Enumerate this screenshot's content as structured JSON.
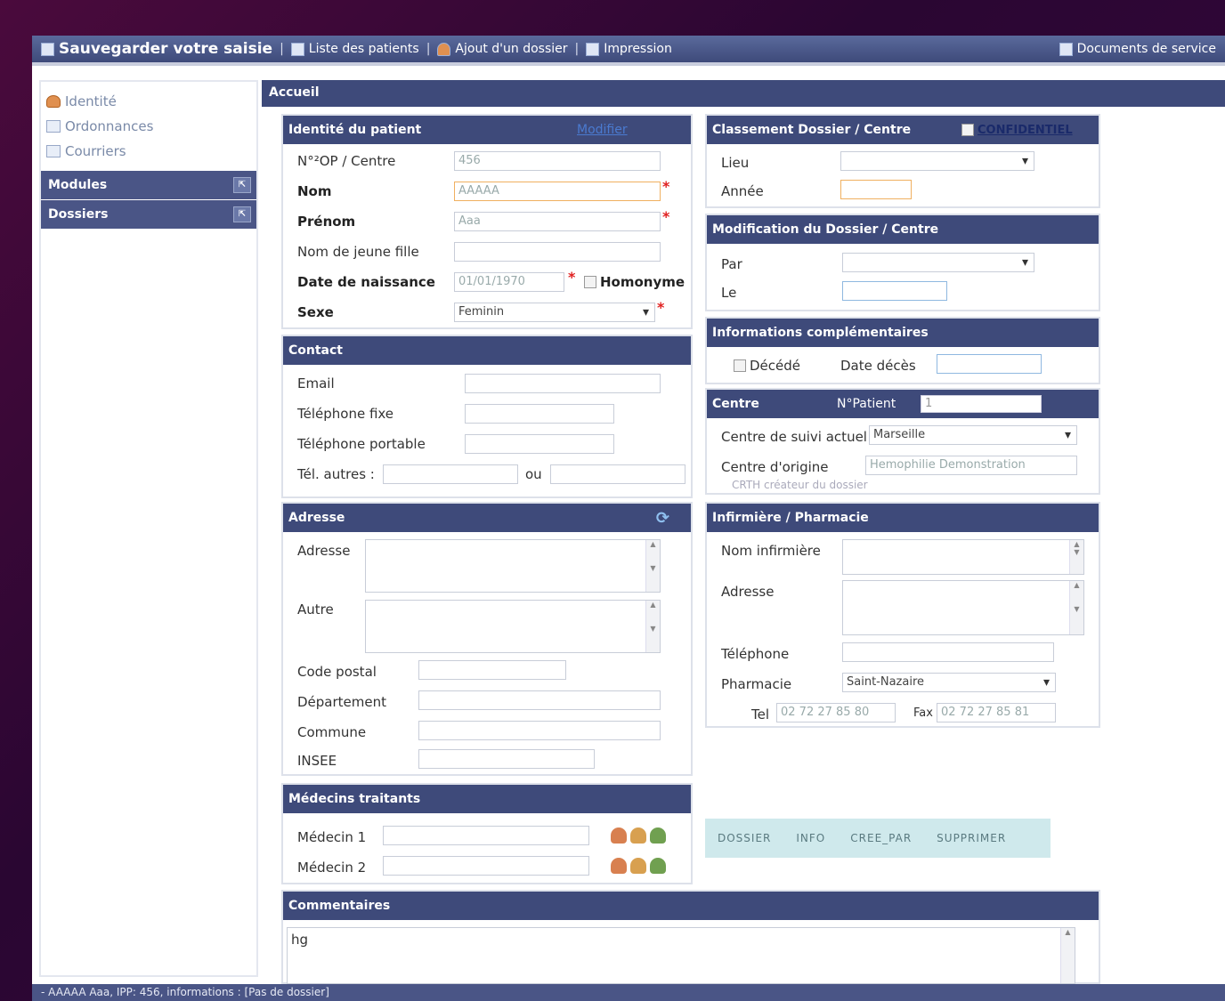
{
  "toolbar": {
    "save": "Sauvegarder votre saisie",
    "patients": "Liste des patients",
    "add": "Ajout d'un dossier",
    "print": "Impression",
    "docs": "Documents de service"
  },
  "sidebar": {
    "links": [
      "Identité",
      "Ordonnances",
      "Courriers"
    ],
    "modules": "Modules",
    "dossiers": "Dossiers"
  },
  "main": {
    "title": "Accueil"
  },
  "identite": {
    "title": "Identité du patient",
    "modifier": "Modifier",
    "nop_label": "N°²OP / Centre",
    "nop_value": "456",
    "nom_label": "Nom",
    "nom_value": "AAAAA",
    "prenom_label": "Prénom",
    "prenom_value": "Aaa",
    "jeune_label": "Nom de jeune fille",
    "naissance_label": "Date de naissance",
    "naissance_value": "01/01/1970",
    "homonyme_label": "Homonyme",
    "sexe_label": "Sexe",
    "sexe_value": "Feminin"
  },
  "contact": {
    "title": "Contact",
    "email": "Email",
    "fixe": "Téléphone fixe",
    "portable": "Téléphone portable",
    "autres": "Tél. autres :",
    "ou": "ou"
  },
  "adresse": {
    "title": "Adresse",
    "adresse": "Adresse",
    "autre": "Autre",
    "cp": "Code postal",
    "dep": "Département",
    "commune": "Commune",
    "insee": "INSEE"
  },
  "medecins": {
    "title": "Médecins traitants",
    "m1": "Médecin 1",
    "m2": "Médecin 2"
  },
  "commentaires": {
    "title": "Commentaires",
    "value": "hg"
  },
  "classement": {
    "title": "Classement Dossier / Centre",
    "confidentiel": "CONFIDENTIEL",
    "lieu": "Lieu",
    "annee": "Année"
  },
  "modification": {
    "title": "Modification du Dossier / Centre",
    "par": "Par",
    "le": "Le"
  },
  "infos": {
    "title": "Informations complémentaires",
    "decede": "Décédé",
    "date_deces": "Date décès"
  },
  "centre": {
    "title": "Centre",
    "npatient_label": "N°Patient",
    "npatient_value": "1",
    "suivi_label": "Centre de suivi actuel",
    "suivi_value": "Marseille",
    "origine_label": "Centre d'origine",
    "origine_value": "Hemophilie Demonstration",
    "createur": "CRTH créateur du dossier"
  },
  "infirmiere": {
    "title": "Infirmière / Pharmacie",
    "nom": "Nom infirmière",
    "adresse": "Adresse",
    "tel": "Téléphone",
    "pharmacie_label": "Pharmacie",
    "pharmacie_value": "Saint-Nazaire",
    "tel_short": "Tel",
    "tel_value": "02 72 27 85 80",
    "fax_label": "Fax",
    "fax_value": "02 72 27 85 81"
  },
  "tabs": [
    "DOSSIER",
    "INFO",
    "CREE_PAR",
    "SUPPRIMER"
  ],
  "status": "- AAAAA Aaa, IPP: 456, informations : [Pas de dossier]",
  "colors": {
    "header": "#3e4a7a",
    "required": "#e02020",
    "tabs_bg": "#cfe9ec"
  }
}
